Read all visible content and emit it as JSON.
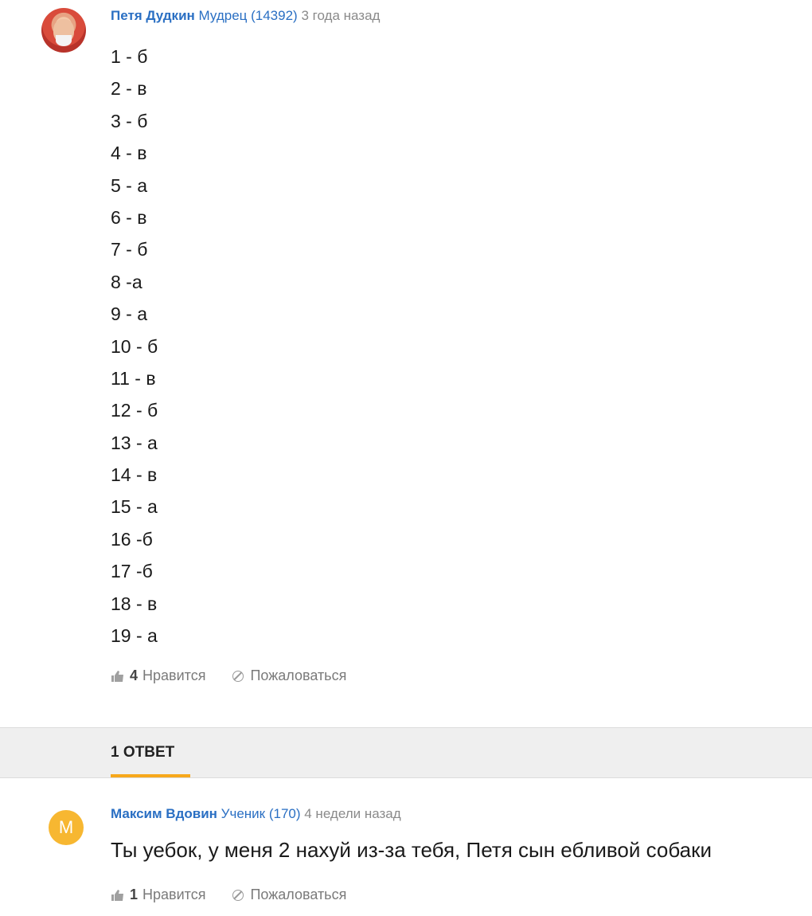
{
  "comment": {
    "author": "Петя Дудкин",
    "rank": "Мудрец (14392)",
    "time": "3 года назад",
    "answers": [
      "1 - б",
      "2 - в",
      "3 - б",
      "4 - в",
      "5 - а",
      "6 - в",
      "7 - б",
      "8 -а",
      "9 - а",
      "10 - б",
      "11 - в",
      "12 - б",
      "13 - а",
      "14 - в",
      "15 - а",
      "16 -б",
      "17 -б",
      "18 - в",
      "19 - а"
    ],
    "likes": "4",
    "like_label": "Нравится",
    "report_label": "Пожаловаться"
  },
  "replies_section": {
    "label": "1 ОТВЕТ",
    "accent": "#f7a81b"
  },
  "reply": {
    "avatar_letter": "М",
    "author": "Максим Вдовин",
    "rank": "Ученик (170)",
    "time": "4 недели назад",
    "text": "Ты уебок, у меня 2 нахуй из-за тебя, Петя сын ебливой собаки",
    "likes": "1",
    "like_label": "Нравится",
    "report_label": "Пожаловаться"
  },
  "colors": {
    "link": "#2a6fc3",
    "muted": "#8a8a8a",
    "avatar": "#f7b731"
  }
}
